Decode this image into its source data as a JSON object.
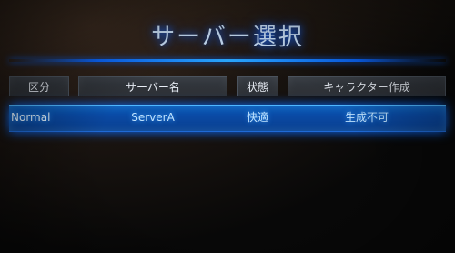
{
  "title": "サーバー選択",
  "table": {
    "headers": [
      "区分",
      "サーバー名",
      "状態",
      "キャラクター作成"
    ],
    "rows": [
      {
        "category": "Normal",
        "server": "ServerA",
        "status": "快適",
        "create": "生成不可"
      }
    ]
  },
  "colors": {
    "accent": "#0a66ff",
    "selected_row": "#0b4fae"
  }
}
